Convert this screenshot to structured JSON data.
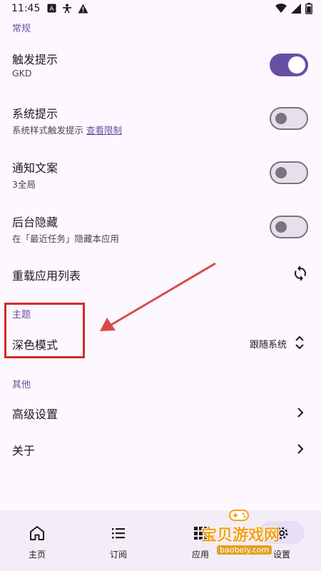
{
  "status_bar": {
    "time": "11:45"
  },
  "sections": {
    "general": "常规",
    "theme": "主题",
    "other": "其他"
  },
  "settings": {
    "touch_hint": {
      "title": "触发提示",
      "subtitle": "GKD",
      "enabled": true
    },
    "system_hint": {
      "title": "系统提示",
      "subtitle": "系统样式触发提示",
      "link": "查看限制",
      "enabled": false
    },
    "notification_text": {
      "title": "通知文案",
      "subtitle": "3全局",
      "enabled": false
    },
    "background_hide": {
      "title": "后台隐藏",
      "subtitle": "在「最近任务」隐藏本应用",
      "enabled": false
    },
    "reload_apps": {
      "title": "重载应用列表"
    },
    "dark_mode": {
      "title": "深色模式",
      "value": "跟随系统"
    },
    "advanced": {
      "title": "高级设置"
    },
    "about": {
      "title": "关于"
    }
  },
  "nav": [
    {
      "label": "主页",
      "icon": "home-icon"
    },
    {
      "label": "订阅",
      "icon": "list-icon"
    },
    {
      "label": "应用",
      "icon": "apps-icon"
    },
    {
      "label": "设置",
      "icon": "settings-icon"
    }
  ],
  "watermark": {
    "text": "宝贝游戏网",
    "url": "baobeiy.com"
  },
  "colors": {
    "accent": "#6750a4",
    "background": "#fdf7ff",
    "annotation": "#d42a2a"
  }
}
